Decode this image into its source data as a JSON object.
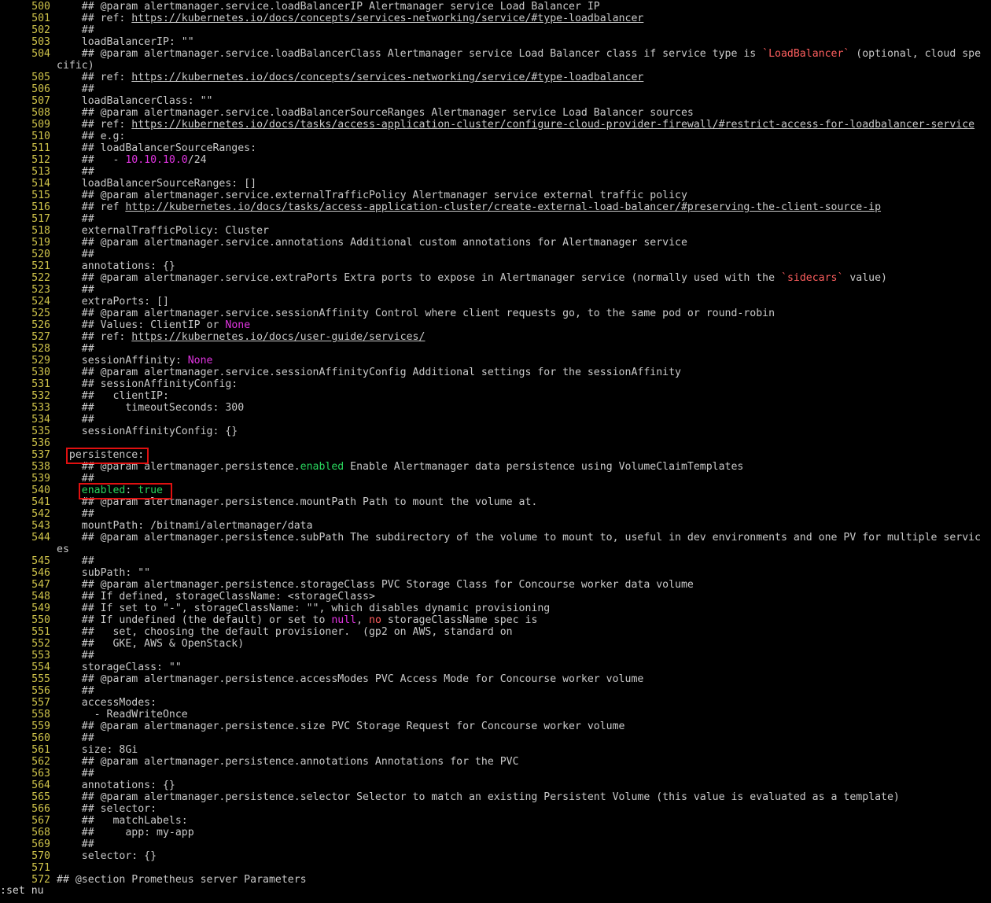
{
  "editor": {
    "mode_command": ":set nu",
    "lines": [
      {
        "n": "500",
        "segs": [
          {
            "t": "    ## @param alertmanager.service.loadBalancerIP Alertmanager service Load Balancer IP"
          }
        ]
      },
      {
        "n": "501",
        "segs": [
          {
            "t": "    ## ref: "
          },
          {
            "t": "https://kubernetes.io/docs/concepts/services-networking/service/#type-loadbalancer",
            "c": "link"
          }
        ]
      },
      {
        "n": "502",
        "segs": [
          {
            "t": "    ##"
          }
        ]
      },
      {
        "n": "503",
        "segs": [
          {
            "t": "    loadBalancerIP: \"\""
          }
        ]
      },
      {
        "n": "504",
        "segs": [
          {
            "t": "    ## @param alertmanager.service.loadBalancerClass Alertmanager service Load Balancer class if service type is "
          },
          {
            "t": "`LoadBalancer`",
            "c": "red"
          },
          {
            "t": " (optional, cloud spe"
          }
        ],
        "cont": "cific)"
      },
      {
        "n": "505",
        "segs": [
          {
            "t": "    ## ref: "
          },
          {
            "t": "https://kubernetes.io/docs/concepts/services-networking/service/#type-loadbalancer",
            "c": "link"
          }
        ]
      },
      {
        "n": "506",
        "segs": [
          {
            "t": "    ##"
          }
        ]
      },
      {
        "n": "507",
        "segs": [
          {
            "t": "    loadBalancerClass: \"\""
          }
        ]
      },
      {
        "n": "508",
        "segs": [
          {
            "t": "    ## @param alertmanager.service.loadBalancerSourceRanges Alertmanager service Load Balancer sources"
          }
        ]
      },
      {
        "n": "509",
        "segs": [
          {
            "t": "    ## ref: "
          },
          {
            "t": "https://kubernetes.io/docs/tasks/access-application-cluster/configure-cloud-provider-firewall/#restrict-access-for-loadbalancer-service",
            "c": "link"
          }
        ]
      },
      {
        "n": "510",
        "segs": [
          {
            "t": "    ## e.g:"
          }
        ]
      },
      {
        "n": "511",
        "segs": [
          {
            "t": "    ## loadBalancerSourceRanges:"
          }
        ]
      },
      {
        "n": "512",
        "segs": [
          {
            "t": "    ##   - "
          },
          {
            "t": "10.10.10.0",
            "c": "magenta"
          },
          {
            "t": "/24"
          }
        ]
      },
      {
        "n": "513",
        "segs": [
          {
            "t": "    ##"
          }
        ]
      },
      {
        "n": "514",
        "segs": [
          {
            "t": "    loadBalancerSourceRanges: []"
          }
        ]
      },
      {
        "n": "515",
        "segs": [
          {
            "t": "    ## @param alertmanager.service.externalTrafficPolicy Alertmanager service external traffic policy"
          }
        ]
      },
      {
        "n": "516",
        "segs": [
          {
            "t": "    ## ref "
          },
          {
            "t": "http://kubernetes.io/docs/tasks/access-application-cluster/create-external-load-balancer/#preserving-the-client-source-ip",
            "c": "link"
          }
        ]
      },
      {
        "n": "517",
        "segs": [
          {
            "t": "    ##"
          }
        ]
      },
      {
        "n": "518",
        "segs": [
          {
            "t": "    externalTrafficPolicy: Cluster"
          }
        ]
      },
      {
        "n": "519",
        "segs": [
          {
            "t": "    ## @param alertmanager.service.annotations Additional custom annotations for Alertmanager service"
          }
        ]
      },
      {
        "n": "520",
        "segs": [
          {
            "t": "    ##"
          }
        ]
      },
      {
        "n": "521",
        "segs": [
          {
            "t": "    annotations: {}"
          }
        ]
      },
      {
        "n": "522",
        "segs": [
          {
            "t": "    ## @param alertmanager.service.extraPorts Extra ports to expose in Alertmanager service (normally used with the "
          },
          {
            "t": "`sidecars`",
            "c": "red"
          },
          {
            "t": " value)"
          }
        ]
      },
      {
        "n": "523",
        "segs": [
          {
            "t": "    ##"
          }
        ]
      },
      {
        "n": "524",
        "segs": [
          {
            "t": "    extraPorts: []"
          }
        ]
      },
      {
        "n": "525",
        "segs": [
          {
            "t": "    ## @param alertmanager.service.sessionAffinity Control where client requests go, to the same pod or round-robin"
          }
        ]
      },
      {
        "n": "526",
        "segs": [
          {
            "t": "    ## Values: ClientIP or "
          },
          {
            "t": "None",
            "c": "magenta"
          }
        ]
      },
      {
        "n": "527",
        "segs": [
          {
            "t": "    ## ref: "
          },
          {
            "t": "https://kubernetes.io/docs/user-guide/services/",
            "c": "link"
          }
        ]
      },
      {
        "n": "528",
        "segs": [
          {
            "t": "    ##"
          }
        ]
      },
      {
        "n": "529",
        "segs": [
          {
            "t": "    sessionAffinity: "
          },
          {
            "t": "None",
            "c": "magenta"
          }
        ]
      },
      {
        "n": "530",
        "segs": [
          {
            "t": "    ## @param alertmanager.service.sessionAffinityConfig Additional settings for the sessionAffinity"
          }
        ]
      },
      {
        "n": "531",
        "segs": [
          {
            "t": "    ## sessionAffinityConfig:"
          }
        ]
      },
      {
        "n": "532",
        "segs": [
          {
            "t": "    ##   clientIP:"
          }
        ]
      },
      {
        "n": "533",
        "segs": [
          {
            "t": "    ##     timeoutSeconds: 300"
          }
        ]
      },
      {
        "n": "534",
        "segs": [
          {
            "t": "    ##"
          }
        ]
      },
      {
        "n": "535",
        "segs": [
          {
            "t": "    sessionAffinityConfig: {}"
          }
        ]
      },
      {
        "n": "536",
        "segs": [
          {
            "t": ""
          }
        ]
      },
      {
        "n": "537",
        "segs": [
          {
            "t": "  persistence:"
          }
        ]
      },
      {
        "n": "538",
        "segs": [
          {
            "t": "    ## @param alertmanager.persistence."
          },
          {
            "t": "enabled",
            "c": "green"
          },
          {
            "t": " Enable Alertmanager data persistence using VolumeClaimTemplates"
          }
        ]
      },
      {
        "n": "539",
        "segs": [
          {
            "t": "    ##"
          }
        ]
      },
      {
        "n": "540",
        "segs": [
          {
            "t": "    "
          },
          {
            "t": "enabled",
            "c": "green"
          },
          {
            "t": ": "
          },
          {
            "t": "true",
            "c": "green"
          }
        ]
      },
      {
        "n": "541",
        "segs": [
          {
            "t": "    ## @param alertmanager.persistence.mountPath Path to mount the volume at."
          }
        ]
      },
      {
        "n": "542",
        "segs": [
          {
            "t": "    ##"
          }
        ]
      },
      {
        "n": "543",
        "segs": [
          {
            "t": "    mountPath: /bitnami/alertmanager/data"
          }
        ]
      },
      {
        "n": "544",
        "segs": [
          {
            "t": "    ## @param alertmanager.persistence.subPath The subdirectory of the volume to mount to, useful in dev environments and one PV for multiple servic"
          }
        ],
        "cont": "es"
      },
      {
        "n": "545",
        "segs": [
          {
            "t": "    ##"
          }
        ]
      },
      {
        "n": "546",
        "segs": [
          {
            "t": "    subPath: \"\""
          }
        ]
      },
      {
        "n": "547",
        "segs": [
          {
            "t": "    ## @param alertmanager.persistence.storageClass PVC Storage Class for Concourse worker data volume"
          }
        ]
      },
      {
        "n": "548",
        "segs": [
          {
            "t": "    ## If defined, storageClassName: <storageClass>"
          }
        ]
      },
      {
        "n": "549",
        "segs": [
          {
            "t": "    ## If set to \"-\", storageClassName: \"\", which disables dynamic provisioning"
          }
        ]
      },
      {
        "n": "550",
        "segs": [
          {
            "t": "    ## If undefined (the default) or set to "
          },
          {
            "t": "null",
            "c": "magenta"
          },
          {
            "t": ", "
          },
          {
            "t": "no",
            "c": "red"
          },
          {
            "t": " storageClassName spec is"
          }
        ]
      },
      {
        "n": "551",
        "segs": [
          {
            "t": "    ##   set, choosing the default provisioner.  (gp2 on AWS, standard on"
          }
        ]
      },
      {
        "n": "552",
        "segs": [
          {
            "t": "    ##   GKE, AWS & OpenStack)"
          }
        ]
      },
      {
        "n": "553",
        "segs": [
          {
            "t": "    ##"
          }
        ]
      },
      {
        "n": "554",
        "segs": [
          {
            "t": "    storageClass: \"\""
          }
        ]
      },
      {
        "n": "555",
        "segs": [
          {
            "t": "    ## @param alertmanager.persistence.accessModes PVC Access Mode for Concourse worker volume"
          }
        ]
      },
      {
        "n": "556",
        "segs": [
          {
            "t": "    ##"
          }
        ]
      },
      {
        "n": "557",
        "segs": [
          {
            "t": "    accessModes:"
          }
        ]
      },
      {
        "n": "558",
        "segs": [
          {
            "t": "      - ReadWriteOnce"
          }
        ]
      },
      {
        "n": "559",
        "segs": [
          {
            "t": "    ## @param alertmanager.persistence.size PVC Storage Request for Concourse worker volume"
          }
        ]
      },
      {
        "n": "560",
        "segs": [
          {
            "t": "    ##"
          }
        ]
      },
      {
        "n": "561",
        "segs": [
          {
            "t": "    size: 8Gi"
          }
        ]
      },
      {
        "n": "562",
        "segs": [
          {
            "t": "    ## @param alertmanager.persistence.annotations Annotations for the PVC"
          }
        ]
      },
      {
        "n": "563",
        "segs": [
          {
            "t": "    ##"
          }
        ]
      },
      {
        "n": "564",
        "segs": [
          {
            "t": "    annotations: {}"
          }
        ]
      },
      {
        "n": "565",
        "segs": [
          {
            "t": "    ## @param alertmanager.persistence.selector Selector to match an existing Persistent Volume (this value is evaluated as a template)"
          }
        ]
      },
      {
        "n": "566",
        "segs": [
          {
            "t": "    ## selector:"
          }
        ]
      },
      {
        "n": "567",
        "segs": [
          {
            "t": "    ##   matchLabels:"
          }
        ]
      },
      {
        "n": "568",
        "segs": [
          {
            "t": "    ##     app: my-app"
          }
        ]
      },
      {
        "n": "569",
        "segs": [
          {
            "t": "    ##"
          }
        ]
      },
      {
        "n": "570",
        "segs": [
          {
            "t": "    selector: {}"
          }
        ]
      },
      {
        "n": "571",
        "segs": [
          {
            "t": ""
          }
        ]
      },
      {
        "n": "572",
        "segs": [
          {
            "t": "## @section Prometheus server Parameters"
          }
        ]
      }
    ]
  },
  "colors": {
    "background": "#000000",
    "text": "#c9c9c9",
    "line_number": "#cfc34a",
    "magenta": "#e034e0",
    "red": "#ff5f5f",
    "green": "#29d65e",
    "highlight_box": "#e01010"
  }
}
